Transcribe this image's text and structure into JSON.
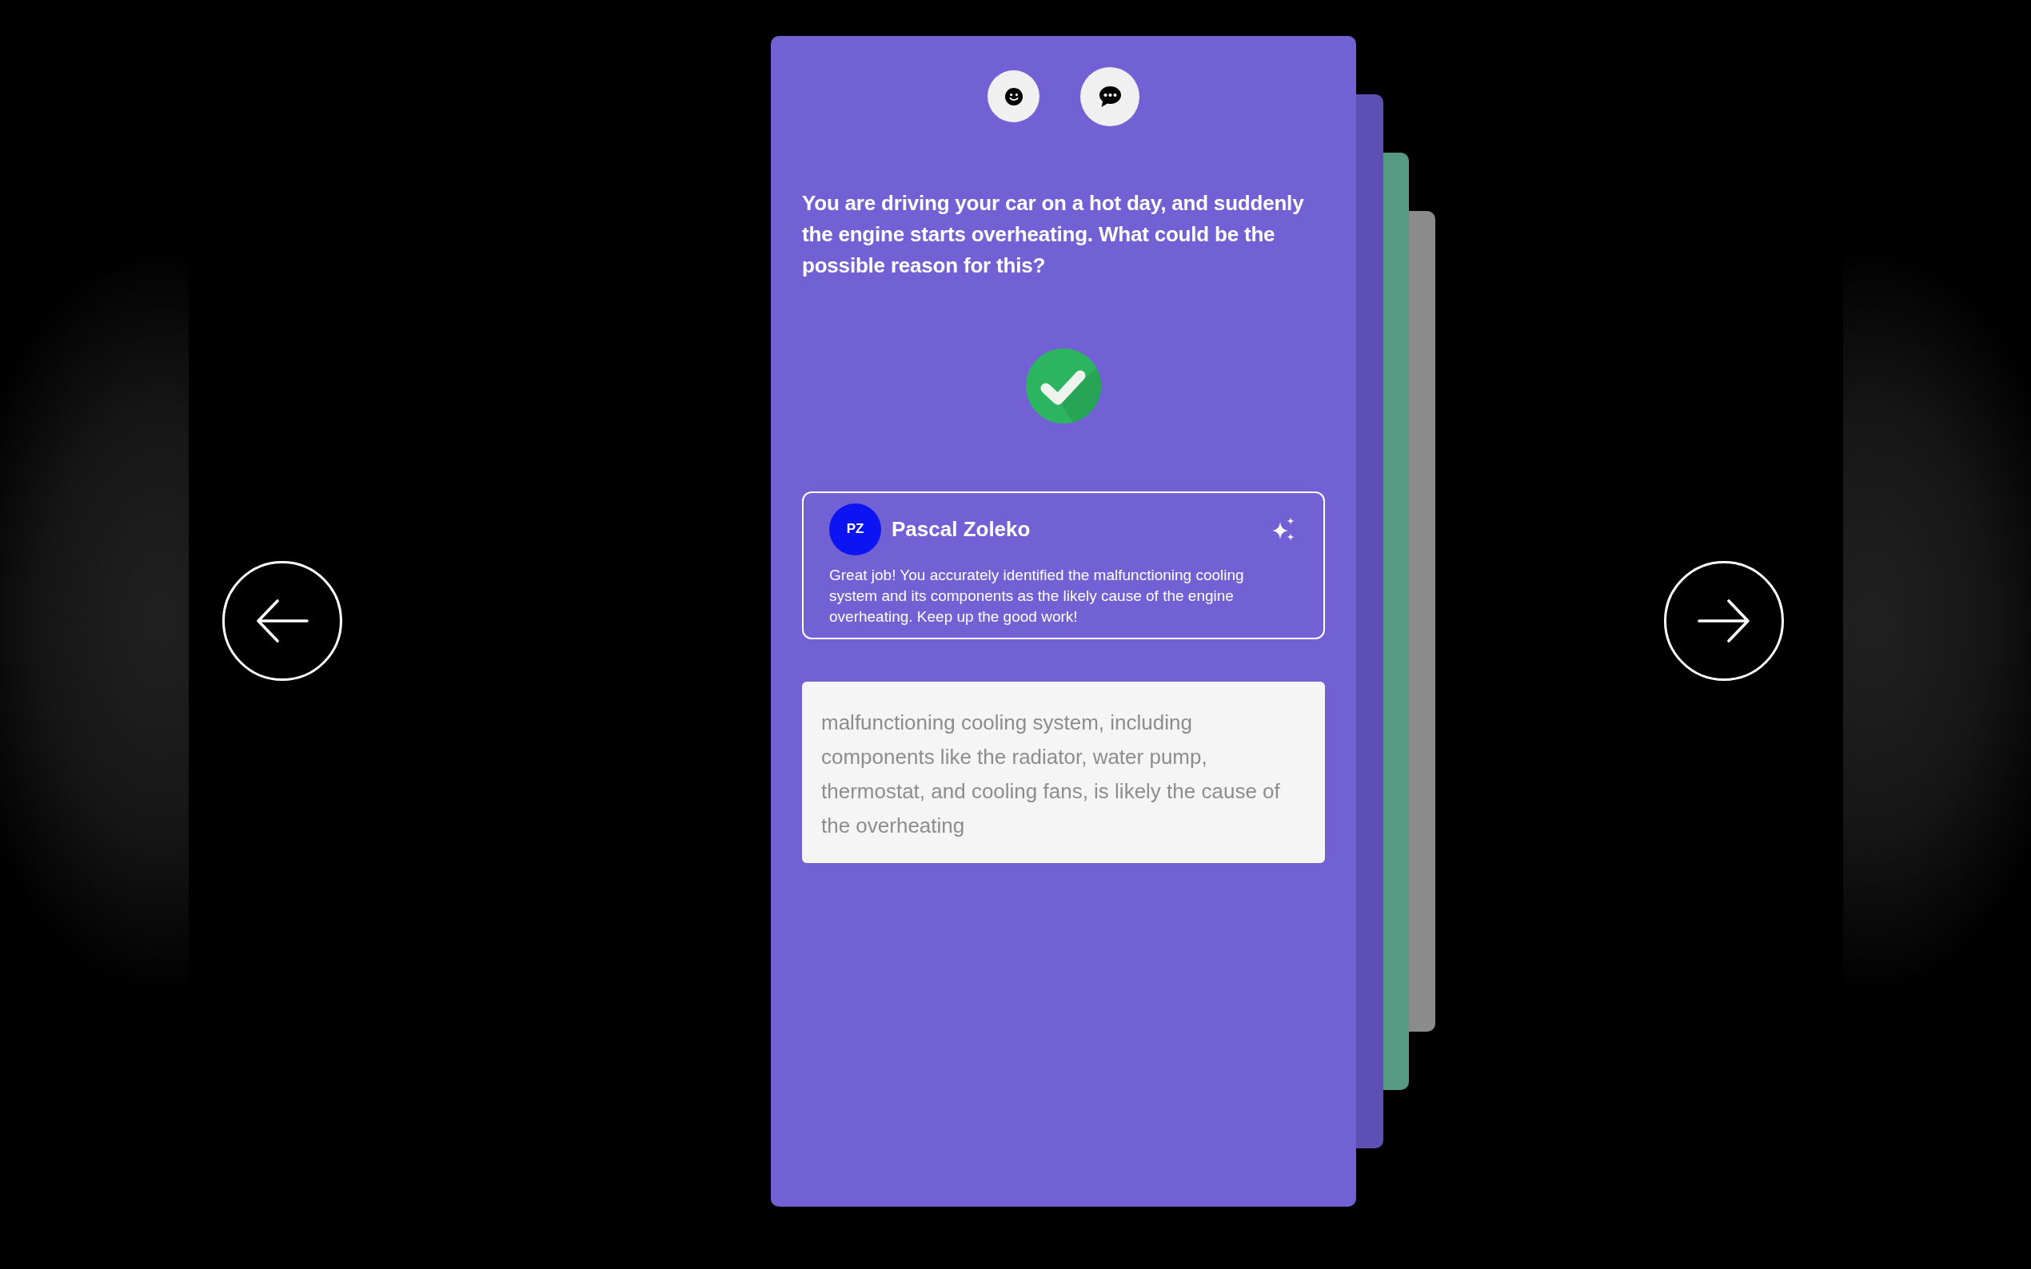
{
  "question": "You are driving your car on a hot day, and suddenly the engine starts overheating. What could be the possible reason for this?",
  "result": {
    "correct": true
  },
  "feedback": {
    "initials": "PZ",
    "author": "Pascal Zoleko",
    "comment": "Great job! You accurately identified the malfunctioning cooling system and its components as the likely cause of the engine overheating. Keep up the good work!"
  },
  "answer": {
    "value": "malfunctioning cooling system, including components like the radiator, water pump, thermostat, and cooling fans, is likely the cause of the overheating"
  },
  "stacked_cards": [
    {
      "color": "#5e4fb4"
    },
    {
      "color": "#569a83"
    },
    {
      "color": "#8b8b8b"
    }
  ]
}
